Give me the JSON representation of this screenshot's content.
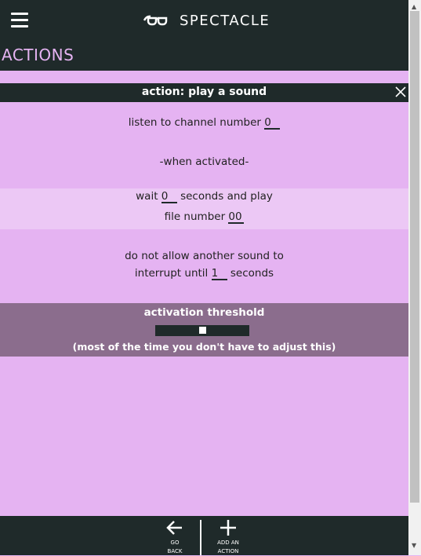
{
  "app": {
    "name": "SPECTACLE"
  },
  "header": {
    "section_title": "ACTIONS"
  },
  "action": {
    "title": "action: play a sound",
    "listen": {
      "prefix": "listen to channel number",
      "channel": "0"
    },
    "when_activated": "-when activated-",
    "wait": {
      "prefix": "wait",
      "seconds": "0",
      "suffix": "seconds and play",
      "file_label": "file number",
      "file": "00"
    },
    "interrupt": {
      "line1": "do not allow another sound to",
      "prefix": "interrupt until",
      "seconds": "1",
      "suffix": "seconds"
    },
    "threshold": {
      "title": "activation threshold",
      "level": 0.5,
      "note": "(most of the time you don't have to adjust this)"
    }
  },
  "footer": {
    "go_back_label": "GO\nBACK",
    "add_action_label": "ADD AN\nACTION"
  },
  "icons": {
    "menu": "hamburger-icon",
    "logo": "glasses-icon",
    "close": "close-icon",
    "back": "arrow-left-icon",
    "add": "plus-icon"
  },
  "colors": {
    "dark": "#1f2a2a",
    "panel": "#e5b3f2",
    "panel_light": "#ecc8f5",
    "threshold": "#8b6d8d"
  }
}
